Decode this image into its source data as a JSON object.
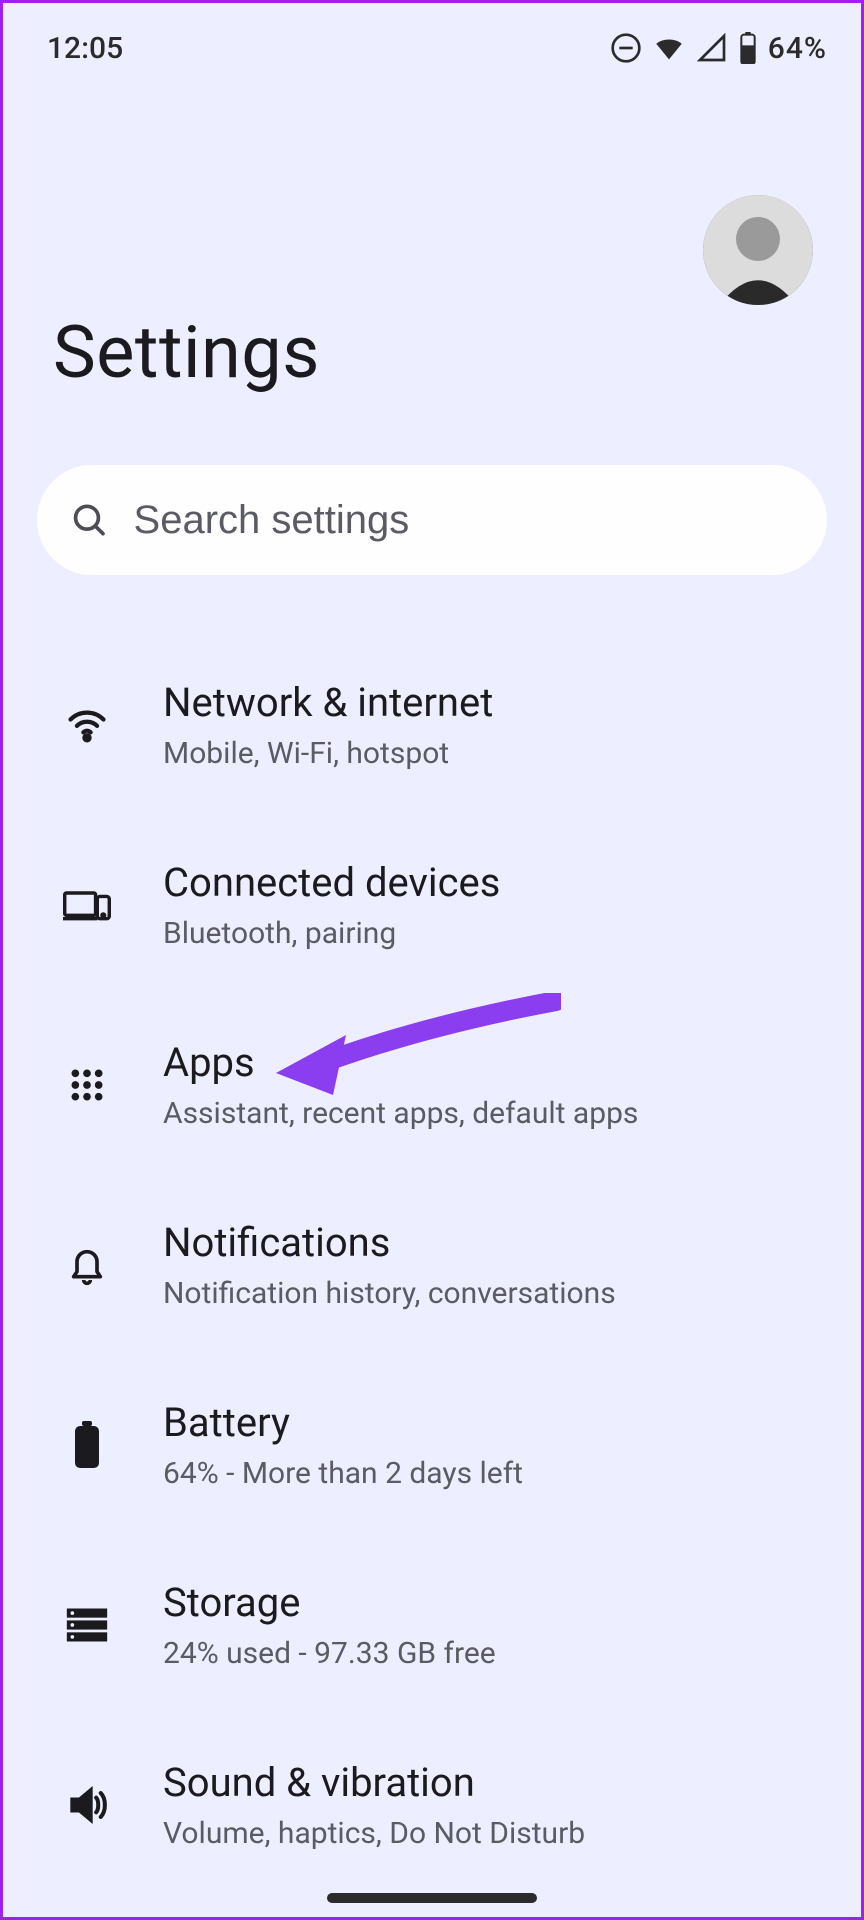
{
  "status": {
    "time": "12:05",
    "battery": "64%"
  },
  "header": {
    "title": "Settings"
  },
  "search": {
    "placeholder": "Search settings"
  },
  "items": [
    {
      "icon": "wifi",
      "title": "Network & internet",
      "sub": "Mobile, Wi-Fi, hotspot"
    },
    {
      "icon": "devices",
      "title": "Connected devices",
      "sub": "Bluetooth, pairing"
    },
    {
      "icon": "apps",
      "title": "Apps",
      "sub": "Assistant, recent apps, default apps"
    },
    {
      "icon": "bell",
      "title": "Notifications",
      "sub": "Notification history, conversations"
    },
    {
      "icon": "battery",
      "title": "Battery",
      "sub": "64% - More than 2 days left"
    },
    {
      "icon": "storage",
      "title": "Storage",
      "sub": "24% used - 97.33 GB free"
    },
    {
      "icon": "sound",
      "title": "Sound & vibration",
      "sub": "Volume, haptics, Do Not Disturb"
    }
  ],
  "annotation": {
    "arrow_color": "#8a3ef0",
    "target": "Apps"
  }
}
